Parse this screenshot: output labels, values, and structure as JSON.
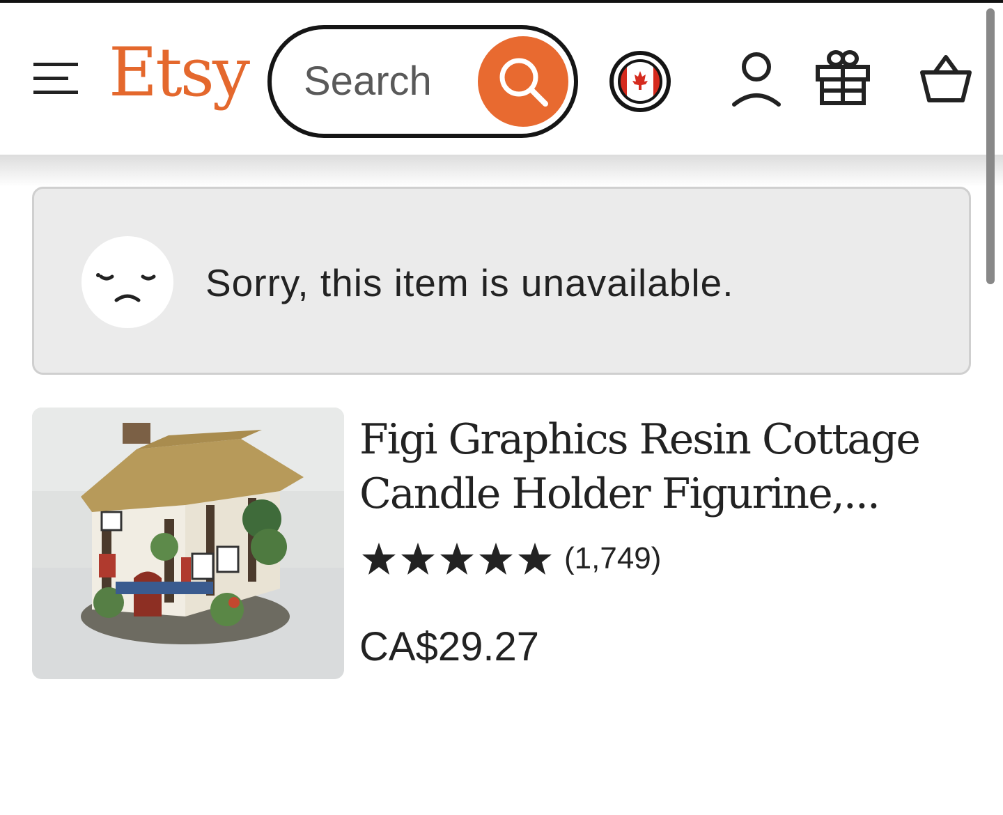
{
  "header": {
    "logo": "Etsy",
    "search_placeholder": "Search"
  },
  "notice": {
    "message": "Sorry, this item is unavailable."
  },
  "product": {
    "title": "Figi Graphics Resin Cottage Candle Holder Figurine,...",
    "rating_stars": 5,
    "review_count": "(1,749)",
    "price": "CA$29.27"
  },
  "colors": {
    "brand_orange": "#e4682d",
    "search_button": "#e86a30",
    "notice_bg": "#ebebeb"
  },
  "icons": [
    "menu-icon",
    "search-icon",
    "canada-flag-icon",
    "user-icon",
    "gift-icon",
    "cart-icon",
    "sad-face-icon",
    "star-icon"
  ]
}
